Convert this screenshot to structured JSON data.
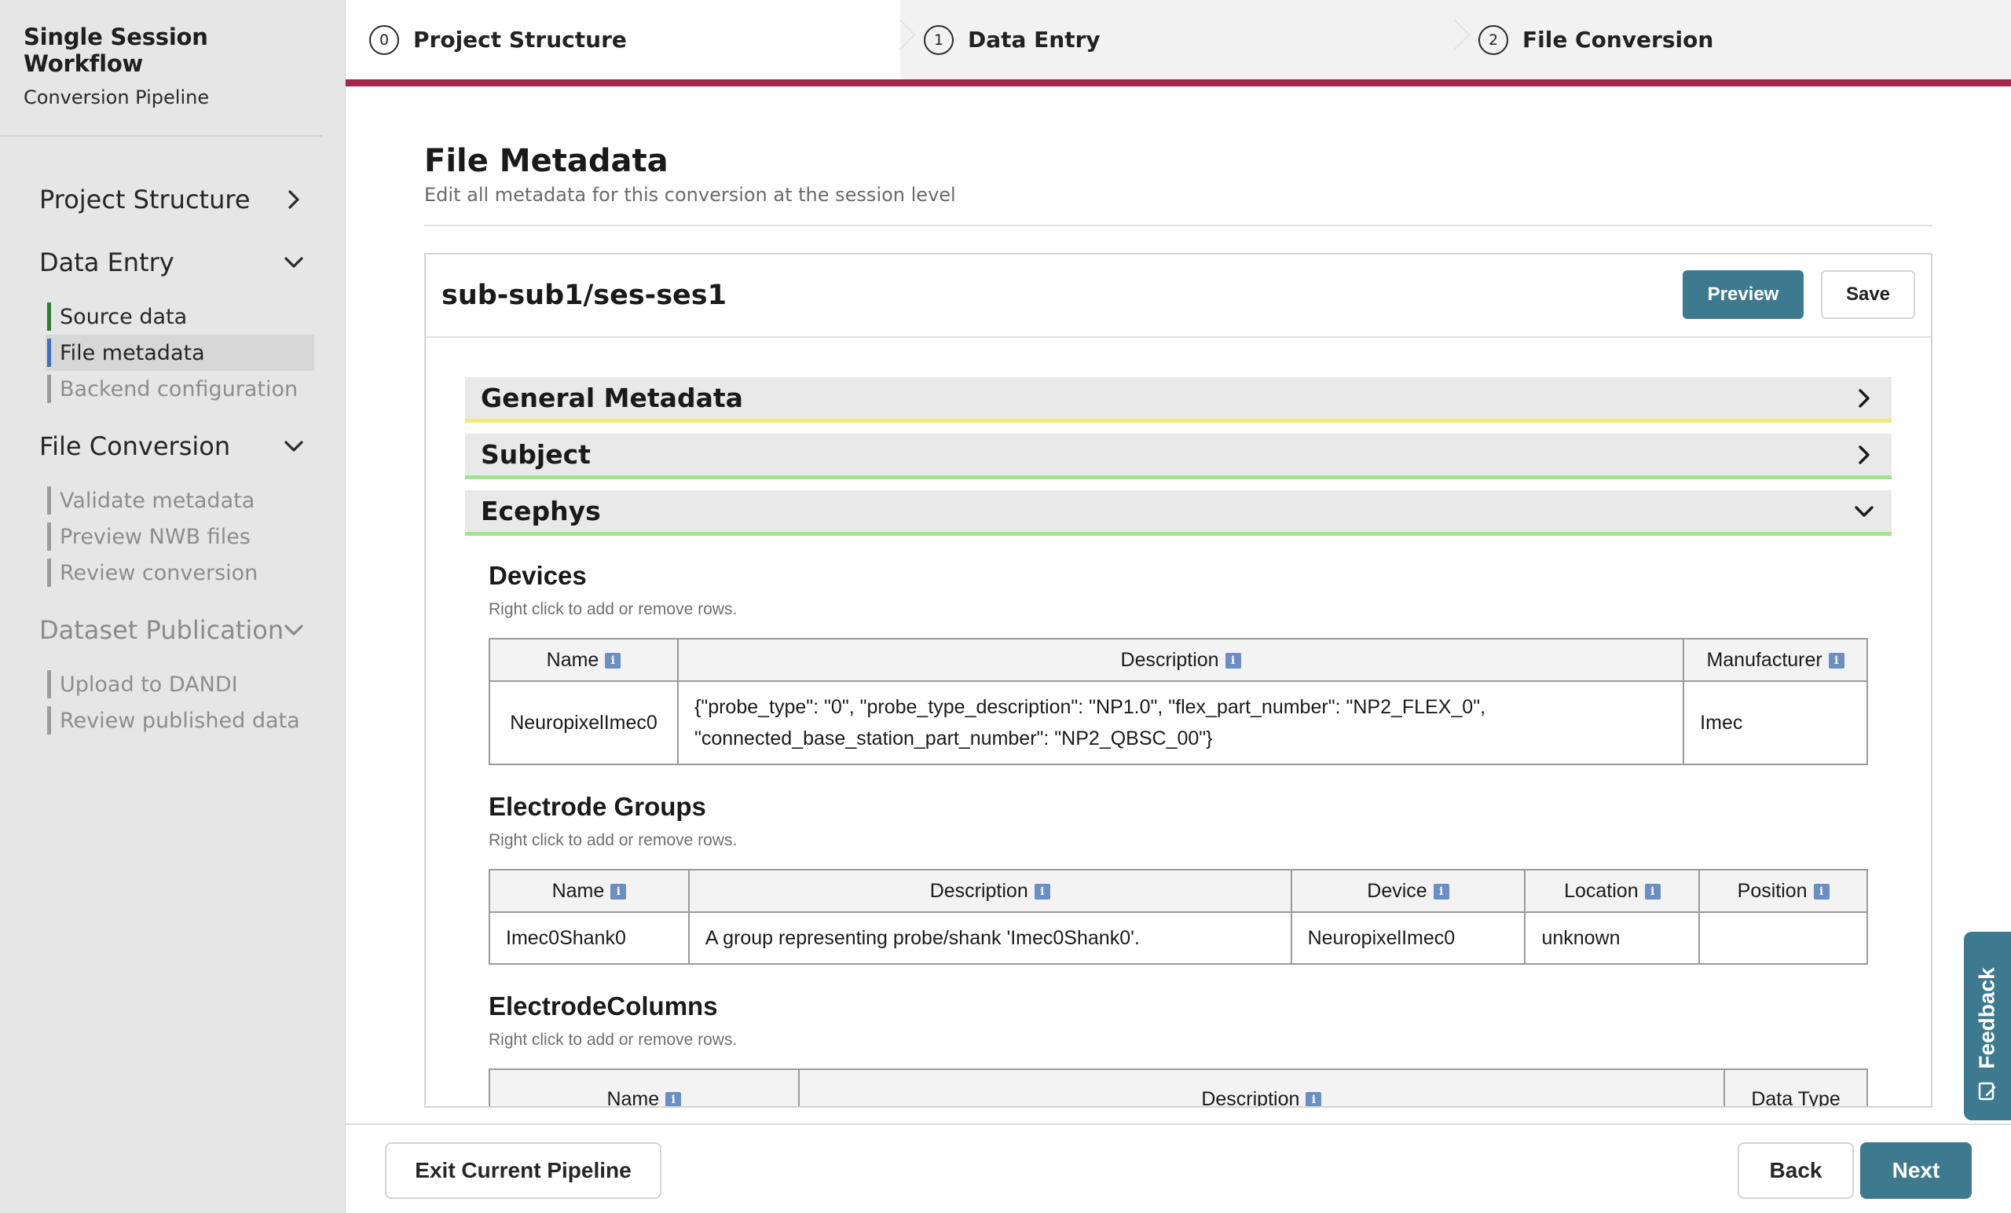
{
  "sidebar": {
    "title": "Single Session Workflow",
    "subtitle": "Conversion Pipeline",
    "sections": [
      {
        "label": "Project Structure",
        "chevron": "chevron-right-icon",
        "items": []
      },
      {
        "label": "Data Entry",
        "chevron": "chevron-down-icon",
        "items": [
          {
            "label": "Source data",
            "state": "done"
          },
          {
            "label": "File metadata",
            "state": "active"
          },
          {
            "label": "Backend configuration",
            "state": "pending"
          }
        ]
      },
      {
        "label": "File Conversion",
        "chevron": "chevron-down-icon",
        "items": [
          {
            "label": "Validate metadata",
            "state": "pending"
          },
          {
            "label": "Preview NWB files",
            "state": "pending"
          },
          {
            "label": "Review conversion",
            "state": "pending"
          }
        ]
      },
      {
        "label": "Dataset Publication",
        "chevron": "chevron-down-icon",
        "items": [
          {
            "label": "Upload to DANDI",
            "state": "pending"
          },
          {
            "label": "Review published data",
            "state": "pending"
          }
        ]
      }
    ]
  },
  "stepper": {
    "steps": [
      {
        "number": "0",
        "label": "Project Structure"
      },
      {
        "number": "1",
        "label": "Data Entry"
      },
      {
        "number": "2",
        "label": "File Conversion"
      }
    ],
    "accent_color": "#a3284a"
  },
  "page": {
    "title": "File Metadata",
    "subtitle": "Edit all metadata for this conversion at the session level"
  },
  "panel": {
    "title": "sub-sub1/ses-ses1",
    "preview_label": "Preview",
    "save_label": "Save"
  },
  "accordions": {
    "general": {
      "label": "General Metadata",
      "color": "#f4e87a"
    },
    "subject": {
      "label": "Subject",
      "color": "#9ee58e"
    },
    "ecephys": {
      "label": "Ecephys",
      "color": "#9ee58e"
    }
  },
  "note": "Right click to add or remove rows.",
  "devices": {
    "title": "Devices",
    "headers": [
      "Name",
      "Description",
      "Manufacturer"
    ],
    "rows": [
      {
        "name": "NeuropixelImec0",
        "description_line1": "{\"probe_type\": \"0\", \"probe_type_description\": \"NP1.0\", \"flex_part_number\": \"NP2_FLEX_0\",",
        "description_line2": "\"connected_base_station_part_number\": \"NP2_QBSC_00\"}",
        "manufacturer": "Imec"
      }
    ]
  },
  "electrode_groups": {
    "title": "Electrode Groups",
    "headers": [
      "Name",
      "Description",
      "Device",
      "Location",
      "Position"
    ],
    "rows": [
      {
        "name": "Imec0Shank0",
        "description": "A group representing probe/shank 'Imec0Shank0'.",
        "device": "NeuropixelImec0",
        "location": "unknown",
        "position": ""
      }
    ]
  },
  "electrode_columns": {
    "title": "ElectrodeColumns",
    "headers": [
      "Name",
      "Description",
      "Data Type"
    ]
  },
  "footer": {
    "exit_label": "Exit Current Pipeline",
    "back_label": "Back",
    "next_label": "Next"
  },
  "feedback": {
    "label": "Feedback",
    "icon": "feedback-icon"
  },
  "colors": {
    "primary": "#3e7a8f",
    "sidebar_bg": "#e6e6e6",
    "active_marker": "#3a6fc6",
    "done_marker": "#2f7d32"
  }
}
